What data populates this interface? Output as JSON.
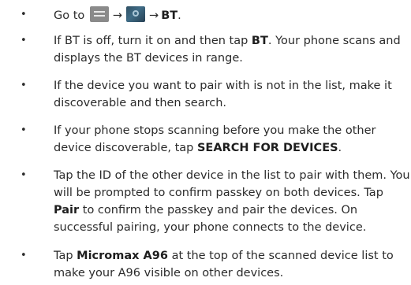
{
  "steps": [
    {
      "prefix": "Go to",
      "arrow1": "→",
      "arrow2": "→",
      "bt": "BT",
      "end": "."
    },
    {
      "t1": "If BT is off, turn it on and then tap ",
      "b1": "BT",
      "t2": ". Your phone scans and displays the BT devices in range."
    },
    {
      "t1": "If the device you want to pair with is not in the list, make it discoverable and then search."
    },
    {
      "t1": "If your phone stops scanning before you make the other device discoverable, tap ",
      "b1": "SEARCH FOR DEVICES",
      "t2": "."
    },
    {
      "t1": "Tap the ID of the other device in the list to pair with them. You will be prompted to confirm passkey on both devices. Tap ",
      "b1": "Pair",
      "t2": " to confirm the passkey and pair the devices. On successful pairing, your phone connects to the device."
    },
    {
      "t1": "Tap ",
      "b1": "Micromax A96",
      "t2": " at the top of the scanned device list to make your A96 visible on other devices."
    }
  ],
  "bullet_char": "•",
  "icons": {
    "apps": "apps-menu-icon",
    "settings": "settings-icon"
  }
}
